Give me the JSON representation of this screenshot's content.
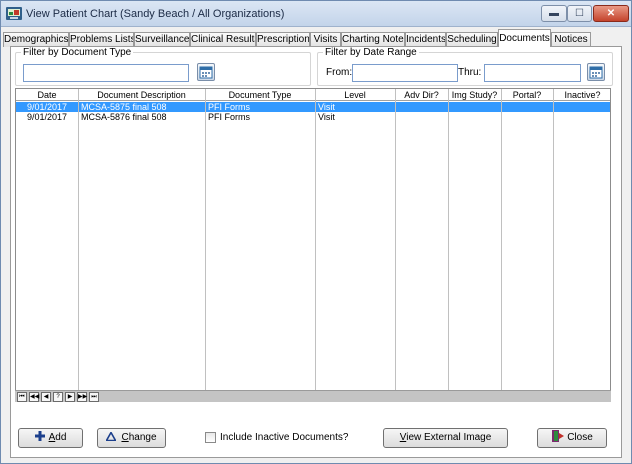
{
  "window": {
    "title": "View Patient Chart (Sandy Beach / All Organizations)",
    "controls": {
      "minimize": "▬",
      "maximize": "☐",
      "close": "✕"
    }
  },
  "tabs": [
    {
      "label": "Demographics"
    },
    {
      "label": "Problems Lists"
    },
    {
      "label": "Surveillance"
    },
    {
      "label": "Clinical Results"
    },
    {
      "label": "Prescriptions"
    },
    {
      "label": "Visits"
    },
    {
      "label": "Charting Notes"
    },
    {
      "label": "Incidents"
    },
    {
      "label": "Scheduling"
    },
    {
      "label": "Documents",
      "active": true
    },
    {
      "label": "Notices"
    }
  ],
  "filters": {
    "doc_type": {
      "legend": "Filter by Document Type",
      "value": "",
      "icon": "calendar-lookup-icon"
    },
    "date_range": {
      "legend": "Filter by Date Range",
      "from_label": "From:",
      "from_value": "",
      "thru_label": "Thru:",
      "thru_value": "",
      "icon": "calendar-icon"
    }
  },
  "table": {
    "columns": [
      "Date",
      "Document Description",
      "Document Type",
      "Level",
      "Adv Dir?",
      "Img Study?",
      "Portal?",
      "Inactive?"
    ],
    "rows": [
      {
        "date": "9/01/2017",
        "description": "MCSA-5875 final 508",
        "type": "PFI Forms",
        "level": "Visit",
        "adv_dir": "",
        "img_study": "",
        "portal": "",
        "inactive": "",
        "selected": true
      },
      {
        "date": "9/01/2017",
        "description": "MCSA-5876 final 508",
        "type": "PFI Forms",
        "level": "Visit",
        "adv_dir": "",
        "img_study": "",
        "portal": "",
        "inactive": "",
        "selected": false
      }
    ]
  },
  "navigator": [
    "⏮",
    "◀◀",
    "◀",
    "?",
    "▶",
    "▶▶",
    "⏭"
  ],
  "footer": {
    "add": {
      "prefix": "",
      "underlined": "A",
      "rest": "dd"
    },
    "change": {
      "underlined": "C",
      "rest": "hange"
    },
    "include_inactive": {
      "label": "Include Inactive Documents?",
      "checked": false
    },
    "view_external": {
      "underlined": "V",
      "rest": "iew External Image"
    },
    "close": {
      "label": "Close"
    }
  },
  "colors": {
    "selection": "#3399ff",
    "add_icon": "#1c3f8c",
    "close_icon": "#7b2a6e"
  }
}
